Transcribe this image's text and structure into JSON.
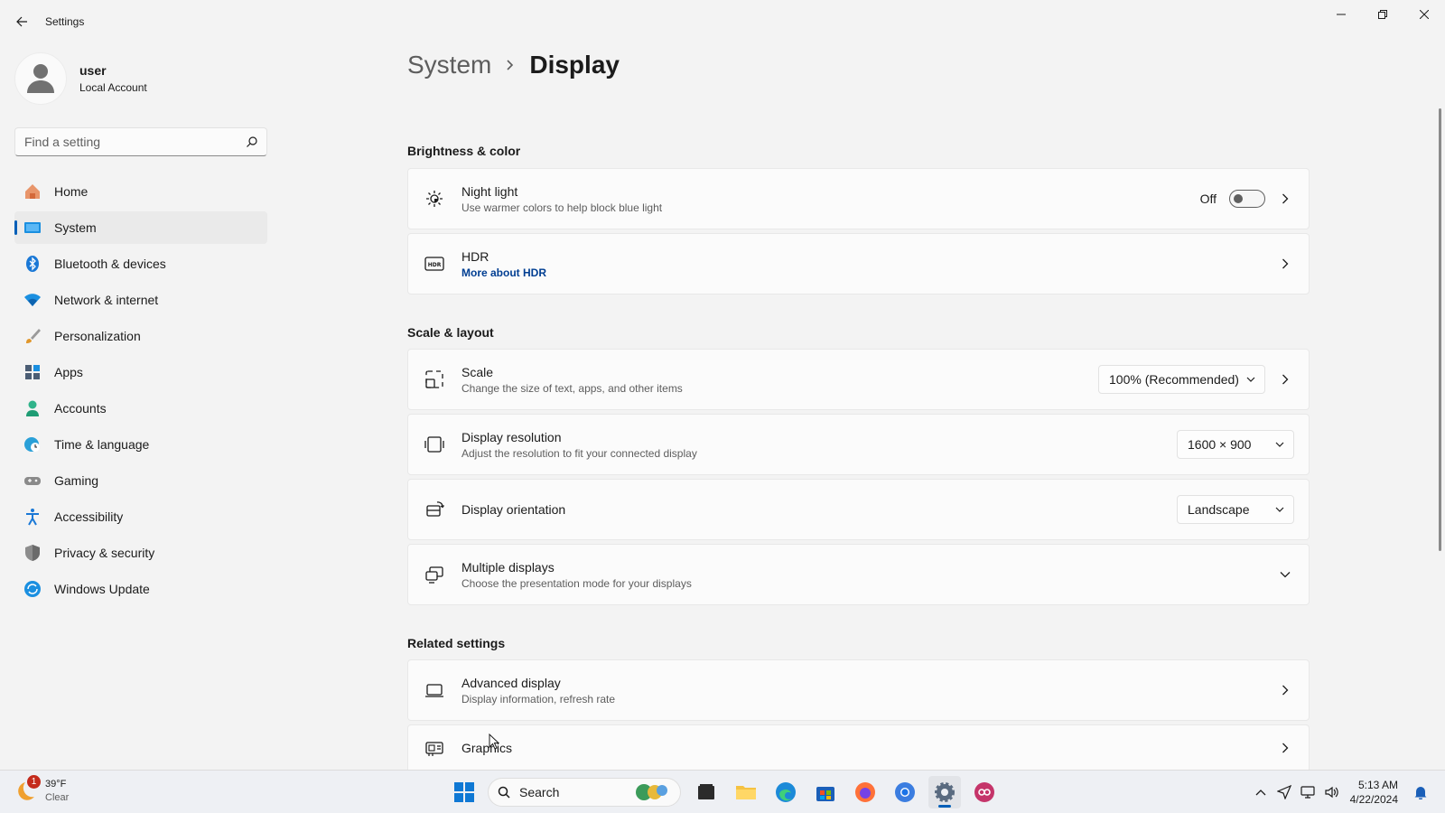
{
  "window": {
    "title": "Settings"
  },
  "profile": {
    "name": "user",
    "account_type": "Local Account"
  },
  "search": {
    "placeholder": "Find a setting"
  },
  "nav": {
    "items": [
      {
        "label": "Home",
        "icon": "home-icon"
      },
      {
        "label": "System",
        "icon": "system-icon",
        "active": true
      },
      {
        "label": "Bluetooth & devices",
        "icon": "bluetooth-icon"
      },
      {
        "label": "Network & internet",
        "icon": "wifi-icon"
      },
      {
        "label": "Personalization",
        "icon": "brush-icon"
      },
      {
        "label": "Apps",
        "icon": "apps-icon"
      },
      {
        "label": "Accounts",
        "icon": "accounts-icon"
      },
      {
        "label": "Time & language",
        "icon": "globe-clock-icon"
      },
      {
        "label": "Gaming",
        "icon": "gamepad-icon"
      },
      {
        "label": "Accessibility",
        "icon": "accessibility-icon"
      },
      {
        "label": "Privacy & security",
        "icon": "shield-icon"
      },
      {
        "label": "Windows Update",
        "icon": "update-icon"
      }
    ]
  },
  "breadcrumb": {
    "parent": "System",
    "current": "Display"
  },
  "sections": {
    "brightness": {
      "title": "Brightness & color",
      "night_light": {
        "title": "Night light",
        "subtitle": "Use warmer colors to help block blue light",
        "toggle_state": "Off"
      },
      "hdr": {
        "title": "HDR",
        "link": "More about HDR"
      }
    },
    "scale_layout": {
      "title": "Scale & layout",
      "scale": {
        "title": "Scale",
        "subtitle": "Change the size of text, apps, and other items",
        "value": "100% (Recommended)"
      },
      "resolution": {
        "title": "Display resolution",
        "subtitle": "Adjust the resolution to fit your connected display",
        "value": "1600 × 900"
      },
      "orientation": {
        "title": "Display orientation",
        "value": "Landscape"
      },
      "multiple": {
        "title": "Multiple displays",
        "subtitle": "Choose the presentation mode for your displays"
      }
    },
    "related": {
      "title": "Related settings",
      "advanced": {
        "title": "Advanced display",
        "subtitle": "Display information, refresh rate"
      },
      "graphics": {
        "title": "Graphics"
      }
    }
  },
  "taskbar": {
    "weather": {
      "temp": "39°F",
      "condition": "Clear",
      "badge": "1"
    },
    "search_label": "Search",
    "clock": {
      "time": "5:13 AM",
      "date": "4/22/2024"
    }
  },
  "colors": {
    "accent": "#005fb8",
    "link": "#003e92"
  }
}
